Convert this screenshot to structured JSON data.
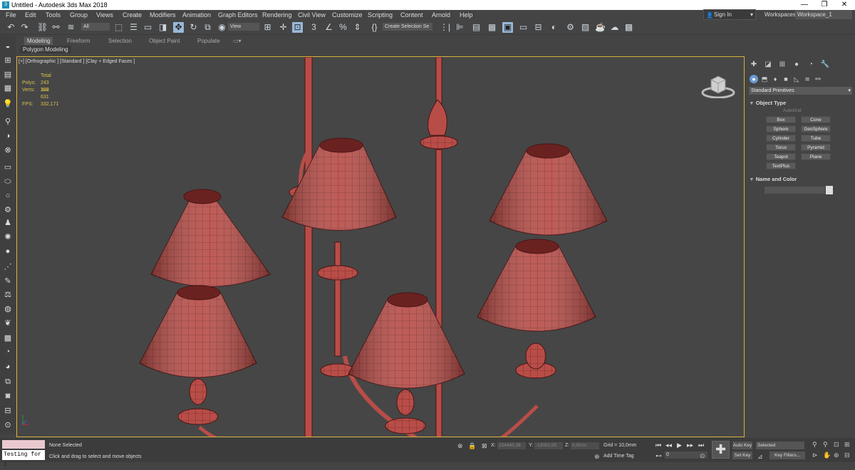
{
  "window": {
    "title": "Untitled - Autodesk 3ds Max 2018",
    "app_icon": "3ds-max-logo",
    "minimize": "—",
    "maximize": "❐",
    "close": "✕"
  },
  "menu": [
    "File",
    "Edit",
    "Tools",
    "Group",
    "Views",
    "Create",
    "Modifiers",
    "Animation",
    "Graph Editors",
    "Rendering",
    "Civil View",
    "Customize",
    "Scripting",
    "Content",
    "Arnold",
    "Help"
  ],
  "account": {
    "signin": "Sign In",
    "workspaces_label": "Workspaces:",
    "workspace": "Workspace_1"
  },
  "toolbar": {
    "filter": "All",
    "ref_coord": "View",
    "selection_set": "Create Selection Se"
  },
  "ribbon": {
    "tabs": [
      "Modeling",
      "Freeform",
      "Selection",
      "Object Paint",
      "Populate"
    ],
    "active_tab": "Modeling",
    "subtab": "Polygon Modeling"
  },
  "viewport": {
    "label": "[+] [Orthographic ] [Standard ] [Clay + Edged Faces ]",
    "stats": {
      "total": "Total",
      "polys_label": "Polys:",
      "polys": "243 388",
      "verts_label": "Verts:",
      "verts": "122 631",
      "fps_label": "FPS:",
      "fps": "332,171"
    }
  },
  "command_panel": {
    "category": "Standard Primitives",
    "object_type_title": "Object Type",
    "autogrid": "AutoGrid",
    "buttons": [
      "Box",
      "Cone",
      "Sphere",
      "GeoSphere",
      "Cylinder",
      "Tube",
      "Torus",
      "Pyramid",
      "Teapot",
      "Plane",
      "TextPlus"
    ],
    "name_color_title": "Name and Color"
  },
  "status": {
    "maxscript": "Testing for :",
    "selection": "None Selected",
    "prompt": "Click and drag to select and move objects",
    "x_label": "X:",
    "x": "154445,36",
    "y_label": "Y:",
    "y": "-13052,55",
    "z_label": "Z:",
    "z": "0,0mm",
    "grid": "Grid = 10,0mm",
    "add_time_tag": "Add Time Tag",
    "frame": "0",
    "autokey": "Auto Key",
    "setkey": "Set Key",
    "selected": "Selected",
    "key_filters": "Key Filters..."
  },
  "colors": {
    "model": "#b84d48",
    "viewport_bg": "#464646",
    "active_border": "#d8b13a"
  }
}
